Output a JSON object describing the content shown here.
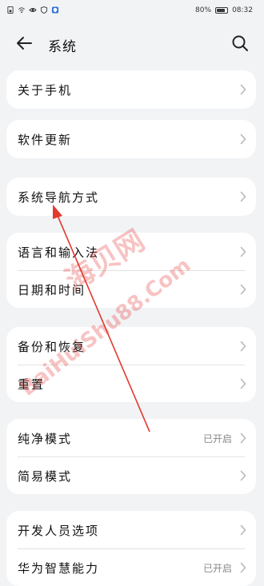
{
  "status": {
    "left_icons": [
      "sim-icon",
      "wifi-icon",
      "eye-icon",
      "shield-icon",
      "app-shield-icon"
    ],
    "battery_percent": "80%",
    "battery_level": 0.8,
    "time": "08:32"
  },
  "header": {
    "title": "系统"
  },
  "cards": [
    {
      "rows": [
        {
          "label": "关于手机",
          "value": ""
        }
      ]
    },
    {
      "rows": [
        {
          "label": "软件更新",
          "value": ""
        }
      ]
    },
    {
      "rows": [
        {
          "label": "系统导航方式",
          "value": ""
        }
      ]
    },
    {
      "rows": [
        {
          "label": "语言和输入法",
          "value": ""
        },
        {
          "label": "日期和时间",
          "value": ""
        }
      ]
    },
    {
      "rows": [
        {
          "label": "备份和恢复",
          "value": ""
        },
        {
          "label": "重置",
          "value": ""
        }
      ]
    },
    {
      "rows": [
        {
          "label": "纯净模式",
          "value": "已开启"
        },
        {
          "label": "简易模式",
          "value": ""
        }
      ]
    },
    {
      "rows": [
        {
          "label": "开发人员选项",
          "value": ""
        },
        {
          "label": "华为智慧能力",
          "value": "已开启"
        }
      ]
    }
  ],
  "watermark": {
    "line1": "海贝网",
    "line2": "BaiHuiShu88.Com"
  },
  "colors": {
    "background": "#f1f3f5",
    "card": "#ffffff",
    "annotation_arrow": "#e23a2e",
    "watermark": "#e62828"
  }
}
